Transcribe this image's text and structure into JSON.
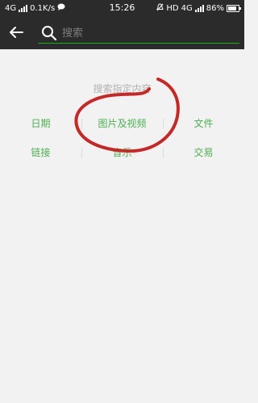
{
  "status_bar": {
    "network": "4G",
    "speed": "0.1K/s",
    "time": "15:26",
    "hd": "HD",
    "network_right": "4G",
    "battery": "86%",
    "battery_level": 0.86
  },
  "search": {
    "placeholder": "搜索"
  },
  "main": {
    "hint": "搜索指定内容",
    "categories": [
      [
        "日期",
        "图片及视频",
        "文件"
      ],
      [
        "链接",
        "音乐",
        "交易"
      ]
    ]
  },
  "colors": {
    "topbar": "#2b2b2b",
    "accent_green": "#1aad19",
    "category_text": "#4caf50",
    "background": "#f2f2f2",
    "annotation_red": "#c62828"
  }
}
